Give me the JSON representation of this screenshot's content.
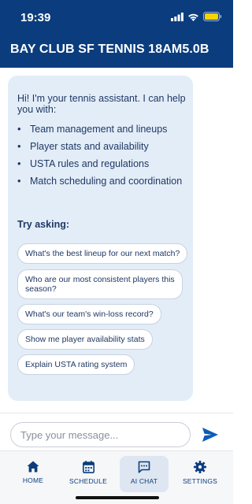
{
  "status": {
    "time": "19:39"
  },
  "header": {
    "title": "BAY CLUB SF TENNIS 18AM5.0B"
  },
  "chat": {
    "intro": "Hi! I'm your tennis assistant. I can help you with:",
    "bullets": [
      "Team management and lineups",
      "Player stats and availability",
      "USTA rules and regulations",
      "Match scheduling and coordination"
    ],
    "try_label": "Try asking:",
    "suggestions": [
      "What's the best lineup for our next match?",
      "Who are our most consistent players this season?",
      "What's our team's win-loss record?",
      "Show me player availability stats",
      "Explain USTA rating system"
    ]
  },
  "input": {
    "placeholder": "Type your message..."
  },
  "tabs": [
    {
      "label": "HOME",
      "icon": "home-icon"
    },
    {
      "label": "SCHEDULE",
      "icon": "calendar-icon"
    },
    {
      "label": "AI CHAT",
      "icon": "chat-icon",
      "active": true
    },
    {
      "label": "SETTINGS",
      "icon": "gear-icon"
    }
  ],
  "colors": {
    "primary": "#0b3d7e",
    "bubble": "#e3edf8",
    "battery": "#f5d400"
  }
}
